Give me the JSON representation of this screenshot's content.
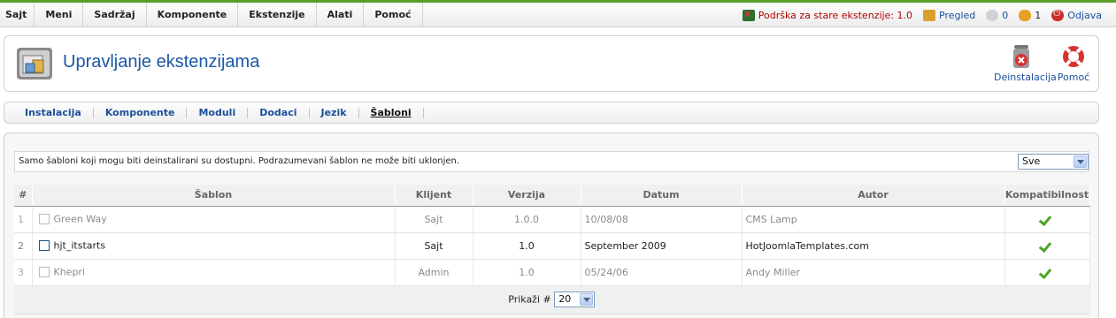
{
  "menu": {
    "items": [
      "Sajt",
      "Meni",
      "Sadržaj",
      "Komponente",
      "Ekstenzije",
      "Alati",
      "Pomoć"
    ]
  },
  "status": {
    "legacy_label": "Podrška za stare ekstenzije: 1.0",
    "preview_label": "Pregled",
    "messages_count": "0",
    "users_count": "1",
    "logout_label": "Odjava",
    "icons": [
      "legacy-icon",
      "preview-icon",
      "messages-icon",
      "users-icon",
      "logout-icon"
    ]
  },
  "header": {
    "title": "Upravljanje ekstenzijama",
    "uninstall_label": "Deinstalacija",
    "help_label": "Pomoć"
  },
  "submenu": {
    "items": [
      "Instalacija",
      "Komponente",
      "Moduli",
      "Dodaci",
      "Jezik",
      "Šabloni"
    ],
    "active": "Šabloni"
  },
  "filter": {
    "message": "Samo šabloni koji mogu biti deinstalirani su dostupni. Podrazumevani šablon ne može biti uklonjen.",
    "select_value": "Sve"
  },
  "table": {
    "headers": [
      "#",
      "Šablon",
      "Klijent",
      "Verzija",
      "Datum",
      "Autor",
      "Kompatibilnost"
    ],
    "rows": [
      {
        "num": "1",
        "name": "Green Way",
        "client": "Sajt",
        "version": "1.0.0",
        "date": "10/08/08",
        "author": "CMS Lamp",
        "compatible": true
      },
      {
        "num": "2",
        "name": "hjt_itstarts",
        "client": "Sajt",
        "version": "1.0",
        "date": "September 2009",
        "author": "HotJoomlaTemplates.com",
        "compatible": true
      },
      {
        "num": "3",
        "name": "Khepri",
        "client": "Admin",
        "version": "1.0",
        "date": "05/24/06",
        "author": "Andy Miller",
        "compatible": true
      }
    ]
  },
  "pager": {
    "label": "Prikaži #",
    "limit": "20"
  },
  "colors": {
    "accent": "#1b57a6",
    "topline": "#5a9e2a",
    "check": "#4ca427"
  }
}
